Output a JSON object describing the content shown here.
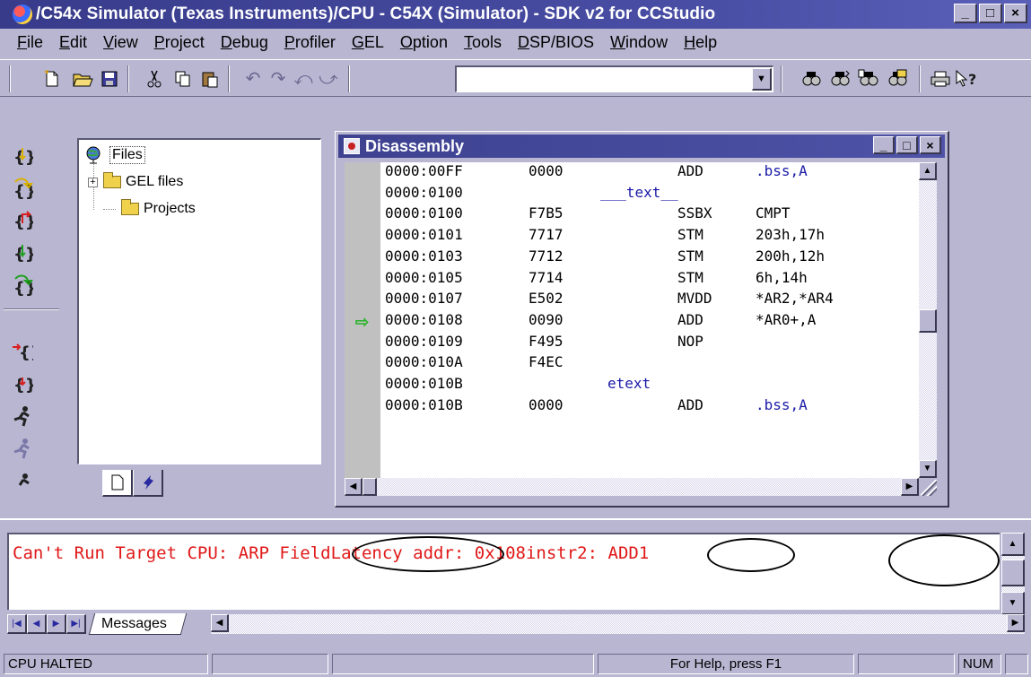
{
  "window": {
    "title": "/C54x Simulator (Texas Instruments)/CPU - C54X (Simulator) - SDK v2 for CCStudio",
    "controls": {
      "minimize": "_",
      "maximize": "□",
      "close": "×"
    }
  },
  "menu": [
    {
      "label": "File"
    },
    {
      "label": "Edit"
    },
    {
      "label": "View"
    },
    {
      "label": "Project"
    },
    {
      "label": "Debug"
    },
    {
      "label": "Profiler"
    },
    {
      "label": "GEL"
    },
    {
      "label": "Option"
    },
    {
      "label": "Tools"
    },
    {
      "label": "DSP/BIOS"
    },
    {
      "label": "Window"
    },
    {
      "label": "Help"
    }
  ],
  "toolbar": {
    "buttons": [
      "new-file",
      "open-folder",
      "save",
      "cut",
      "copy",
      "paste",
      "undo",
      "redo",
      "undo-edit",
      "redo-edit"
    ],
    "search_value": "",
    "right_buttons": [
      "find",
      "find-next",
      "find-in-files",
      "replace",
      "print",
      "context-help"
    ]
  },
  "debug_toolbar": [
    "step-into",
    "step-over",
    "step-out",
    "run",
    "run-to-cursor",
    "set-pc",
    "toggle-breakpoint",
    "run",
    "halt",
    "animate"
  ],
  "project_tree": {
    "root": "Files",
    "items": [
      {
        "label": "GEL files",
        "expander": "+"
      },
      {
        "label": "Projects"
      }
    ]
  },
  "disassembly": {
    "title": "Disassembly",
    "current_line_index": 7,
    "rows": [
      {
        "addr": "0000:00FF",
        "op": "0000",
        "mnemonic": "ADD",
        "args": ".bss,A"
      },
      {
        "addr": "0000:0100",
        "label": "___text__"
      },
      {
        "addr": "0000:0100",
        "op": "F7B5",
        "mnemonic": "SSBX",
        "args": "CMPT"
      },
      {
        "addr": "0000:0101",
        "op": "7717",
        "mnemonic": "STM",
        "args": "203h,17h"
      },
      {
        "addr": "0000:0103",
        "op": "7712",
        "mnemonic": "STM",
        "args": "200h,12h"
      },
      {
        "addr": "0000:0105",
        "op": "7714",
        "mnemonic": "STM",
        "args": "6h,14h"
      },
      {
        "addr": "0000:0107",
        "op": "E502",
        "mnemonic": "MVDD",
        "args": "*AR2,*AR4"
      },
      {
        "addr": "0000:0108",
        "op": "0090",
        "mnemonic": "ADD",
        "args": "*AR0+,A"
      },
      {
        "addr": "0000:0109",
        "op": "F495",
        "mnemonic": "NOP",
        "args": ""
      },
      {
        "addr": "0000:010A",
        "op": "F4EC",
        "mnemonic": "",
        "args": ""
      },
      {
        "addr": "0000:010B",
        "label": "etext"
      },
      {
        "addr": "0000:010B",
        "op": "0000",
        "mnemonic": "ADD",
        "args": ".bss,A"
      }
    ]
  },
  "messages": {
    "line_parts": [
      "Can't Run Target CPU: ",
      "ARP Field",
      "Latency addr: ",
      "0x108",
      "instr2",
      ": ADD1"
    ],
    "tab": "Messages",
    "text_color": "#e01818"
  },
  "statusbar": {
    "state": "CPU HALTED",
    "help": "For Help, press F1",
    "num": "NUM"
  },
  "colors": {
    "face": "#b9b6d2",
    "titlebar": "#383b8a",
    "pc_arrow": "#28b428",
    "label_text": "#1a1aa8"
  }
}
